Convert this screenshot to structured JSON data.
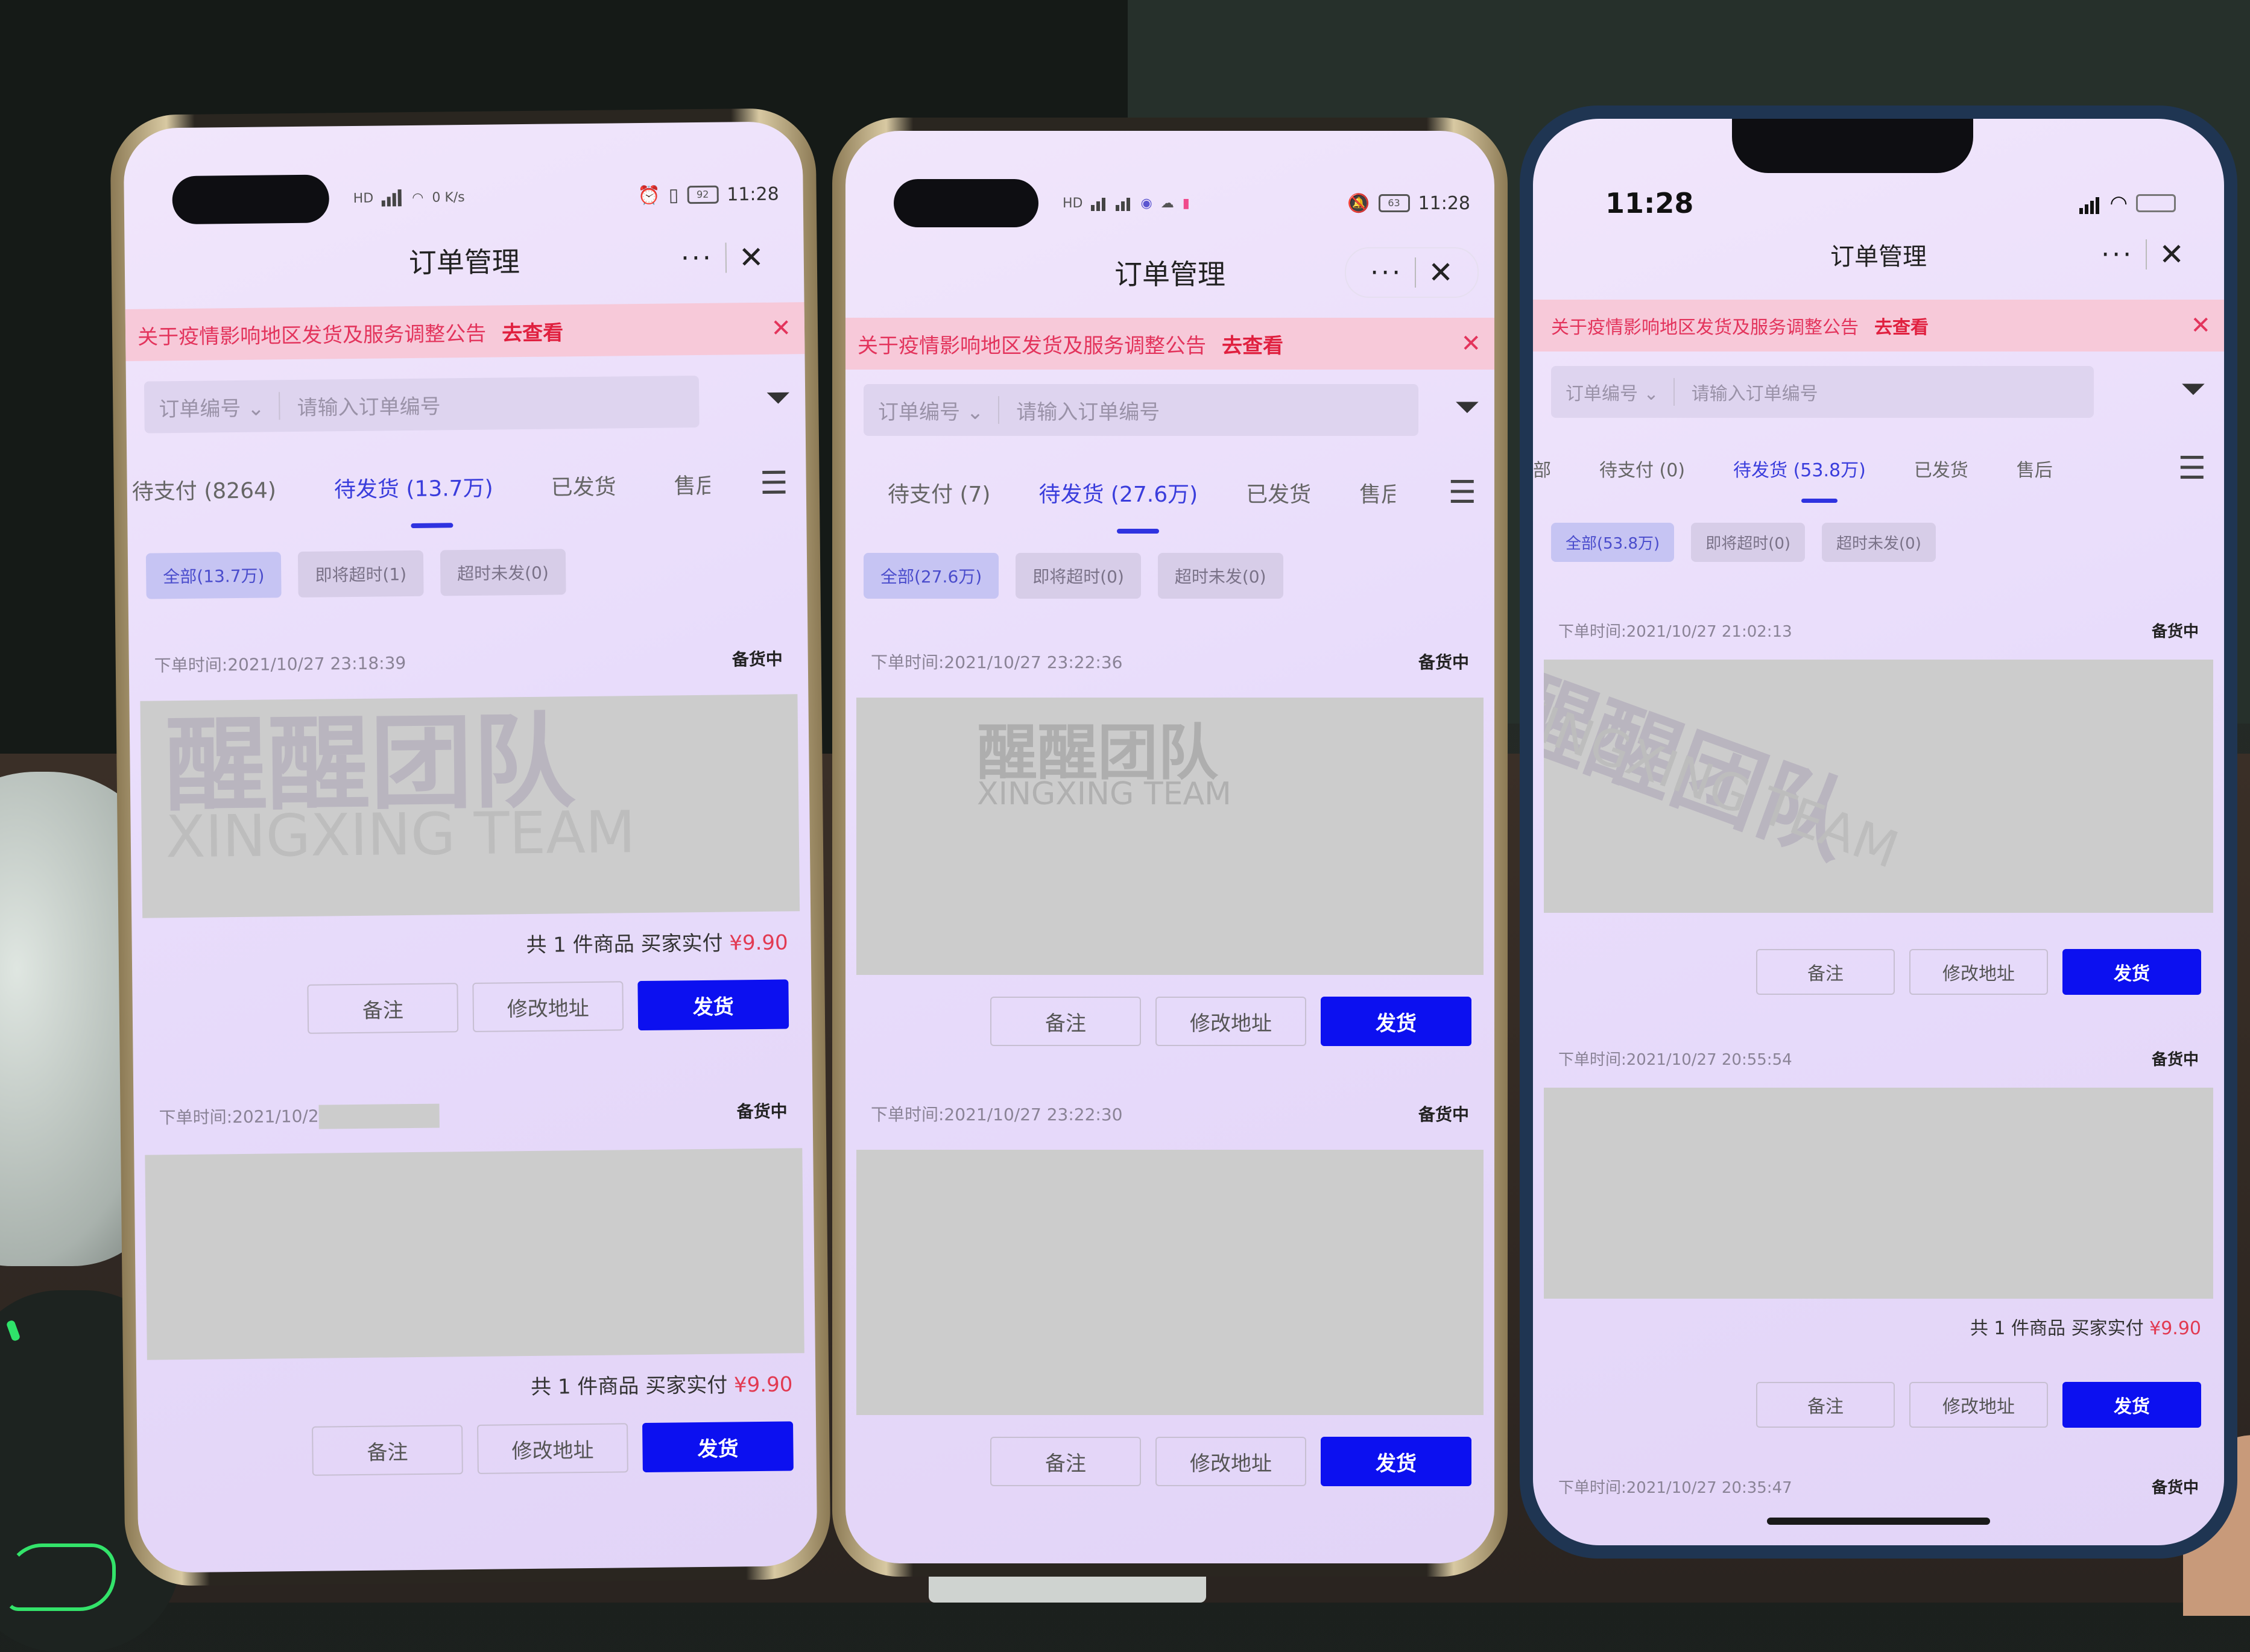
{
  "scene": {
    "description": "Three phones side by side showing the same order management mini-program"
  },
  "phones": [
    {
      "status_bar": {
        "left_icons": [
          "HD",
          "signal",
          "wifi",
          "0 K/s"
        ],
        "right_icons": [
          "alarm",
          "vibrate",
          "92"
        ],
        "time": "11:28"
      },
      "nav": {
        "title": "订单管理",
        "more_label": "···",
        "close_label": "✕"
      },
      "notice": {
        "text": "关于疫情影响地区发货及服务调整公告",
        "link": "去查看",
        "close_label": "✕"
      },
      "search": {
        "type_label": "订单编号",
        "placeholder": "请输入订单编号"
      },
      "tabs": [
        "待支付 (8264)",
        "待发货 (13.7万)",
        "已发货",
        "售后"
      ],
      "active_tab_index": 1,
      "chips": [
        "全部(13.7万)",
        "即将超时(1)",
        "超时未发(0)"
      ],
      "orders": [
        {
          "time": "下单时间:2021/10/27 23:18:39",
          "status": "备货中",
          "summary_prefix": "共 1 件商品  买家实付 ",
          "price": "¥9.90",
          "buttons": [
            "备注",
            "修改地址",
            "发货"
          ]
        },
        {
          "time": "下单时间:2021/10/2",
          "status": "备货中",
          "summary_prefix": "共 1 件商品  买家实付 ",
          "price": "¥9.90",
          "buttons": [
            "备注",
            "修改地址",
            "发货"
          ]
        }
      ]
    },
    {
      "status_bar": {
        "left_icons": [
          "HD",
          "HD",
          "5G",
          "4G",
          "app",
          "cloud",
          "app"
        ],
        "right_icons": [
          "mute",
          "63"
        ],
        "time": "11:28"
      },
      "nav": {
        "title": "订单管理",
        "more_label": "···",
        "close_label": "✕"
      },
      "notice": {
        "text": "关于疫情影响地区发货及服务调整公告",
        "link": "去查看",
        "close_label": "✕"
      },
      "search": {
        "type_label": "订单编号",
        "placeholder": "请输入订单编号"
      },
      "tabs": [
        "待支付 (7)",
        "待发货 (27.6万)",
        "已发货",
        "售后"
      ],
      "active_tab_index": 1,
      "chips": [
        "全部(27.6万)",
        "即将超时(0)",
        "超时未发(0)"
      ],
      "orders": [
        {
          "time": "下单时间:2021/10/27 23:22:36",
          "status": "备货中",
          "buttons": [
            "备注",
            "修改地址",
            "发货"
          ]
        },
        {
          "time": "下单时间:2021/10/27 23:22:30",
          "status": "备货中",
          "buttons": [
            "备注",
            "修改地址",
            "发货"
          ]
        }
      ]
    },
    {
      "status_bar": {
        "time": "11:28",
        "right_icons": [
          "signal",
          "wifi",
          "battery"
        ]
      },
      "nav": {
        "title": "订单管理",
        "more_label": "···",
        "close_label": "✕"
      },
      "notice": {
        "text": "关于疫情影响地区发货及服务调整公告",
        "link": "去查看",
        "close_label": "✕"
      },
      "search": {
        "type_label": "订单编号",
        "placeholder": "请输入订单编号"
      },
      "tabs": [
        "部",
        "待支付 (0)",
        "待发货 (53.8万)",
        "已发货",
        "售后"
      ],
      "active_tab_index": 2,
      "chips": [
        "全部(53.8万)",
        "即将超时(0)",
        "超时未发(0)"
      ],
      "orders": [
        {
          "time": "下单时间:2021/10/27 21:02:13",
          "status": "备货中",
          "buttons": [
            "备注",
            "修改地址",
            "发货"
          ]
        },
        {
          "time": "下单时间:2021/10/27 20:55:54",
          "status": "备货中",
          "summary_prefix": "共 1 件商品  买家实付 ",
          "price": "¥9.90",
          "buttons": [
            "备注",
            "修改地址",
            "发货"
          ]
        },
        {
          "time": "下单时间:2021/10/27 20:35:47",
          "status": "备货中"
        }
      ]
    }
  ],
  "watermark": {
    "cn": "醒醒团队",
    "en": "XINGXING TEAM"
  },
  "colors": {
    "accent_blue": "#0c10f0",
    "notice_red": "#e3345c",
    "notice_bg": "#f7c9d9",
    "screen_tint": "#e8dcfb",
    "masked_gray": "#cccccc"
  }
}
